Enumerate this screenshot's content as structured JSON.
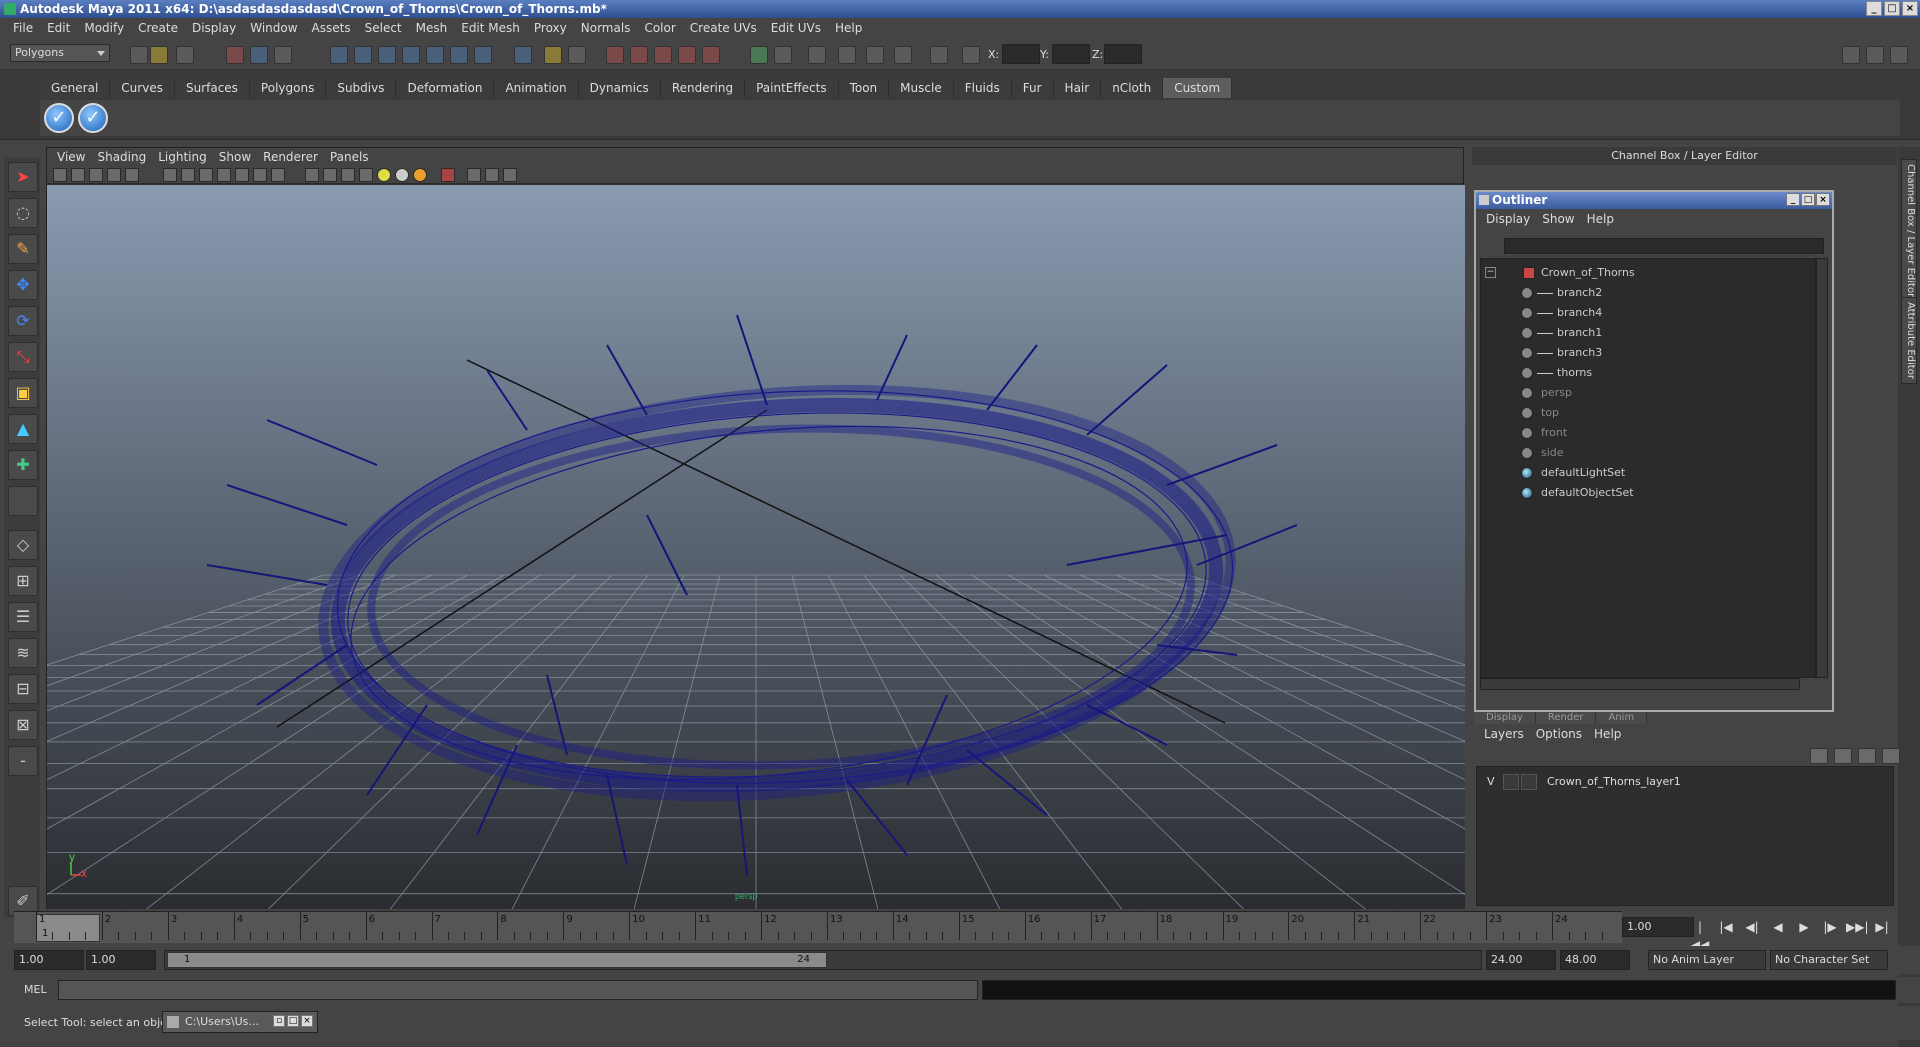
{
  "window": {
    "title": "Autodesk Maya 2011 x64: D:\\asdasdasdasdasd\\Crown_of_Thorns\\Crown_of_Thorns.mb*"
  },
  "menus": [
    "File",
    "Edit",
    "Modify",
    "Create",
    "Display",
    "Window",
    "Assets",
    "Select",
    "Mesh",
    "Edit Mesh",
    "Proxy",
    "Normals",
    "Color",
    "Create UVs",
    "Edit UVs",
    "Help"
  ],
  "status_line": {
    "mode": "Polygons",
    "x_label": "X:",
    "y_label": "Y:",
    "z_label": "Z:"
  },
  "shelf": {
    "tabs": [
      "General",
      "Curves",
      "Surfaces",
      "Polygons",
      "Subdivs",
      "Deformation",
      "Animation",
      "Dynamics",
      "Rendering",
      "PaintEffects",
      "Toon",
      "Muscle",
      "Fluids",
      "Fur",
      "Hair",
      "nCloth",
      "Custom"
    ],
    "active_tab": "Custom"
  },
  "viewport": {
    "menus": [
      "View",
      "Shading",
      "Lighting",
      "Show",
      "Renderer",
      "Panels"
    ],
    "axis_y": "y",
    "axis_x": "x",
    "camera_label": "persp"
  },
  "channel_box": {
    "title": "Channel Box / Layer Editor",
    "side_tab_1": "Channel Box / Layer Editor",
    "side_tab_2": "Attribute Editor"
  },
  "outliner": {
    "title": "Outliner",
    "menus": [
      "Display",
      "Show",
      "Help"
    ],
    "items": [
      {
        "label": "Crown_of_Thorns",
        "level": 0,
        "dim": false,
        "kind": "root"
      },
      {
        "label": "branch2",
        "level": 1,
        "dim": false,
        "kind": "mesh"
      },
      {
        "label": "branch4",
        "level": 1,
        "dim": false,
        "kind": "mesh"
      },
      {
        "label": "branch1",
        "level": 1,
        "dim": false,
        "kind": "mesh"
      },
      {
        "label": "branch3",
        "level": 1,
        "dim": false,
        "kind": "mesh"
      },
      {
        "label": "thorns",
        "level": 1,
        "dim": false,
        "kind": "mesh"
      },
      {
        "label": "persp",
        "level": 0,
        "dim": true,
        "kind": "camera"
      },
      {
        "label": "top",
        "level": 0,
        "dim": true,
        "kind": "camera"
      },
      {
        "label": "front",
        "level": 0,
        "dim": true,
        "kind": "camera"
      },
      {
        "label": "side",
        "level": 0,
        "dim": true,
        "kind": "camera"
      },
      {
        "label": "defaultLightSet",
        "level": 0,
        "dim": false,
        "kind": "set"
      },
      {
        "label": "defaultObjectSet",
        "level": 0,
        "dim": false,
        "kind": "set"
      }
    ]
  },
  "layer_editor": {
    "tabs": [
      "Display",
      "Render",
      "Anim"
    ],
    "menus": [
      "Layers",
      "Options",
      "Help"
    ],
    "layer": {
      "visibility": "V",
      "name": "Crown_of_Thorns_layer1"
    }
  },
  "timeline": {
    "ticks": [
      "1",
      "2",
      "3",
      "4",
      "5",
      "6",
      "7",
      "8",
      "9",
      "10",
      "11",
      "12",
      "13",
      "14",
      "15",
      "16",
      "17",
      "18",
      "19",
      "20",
      "21",
      "22",
      "23",
      "24"
    ],
    "current_frame_label": "1",
    "current_time": "1.00"
  },
  "playback": {
    "buttons": [
      "|◀◀",
      "|◀",
      "◀|",
      "◀",
      "▶",
      "|▶",
      "▶▶|",
      "▶|"
    ]
  },
  "range": {
    "start": "1.00",
    "playback_start": "1.00",
    "handle_start": "1",
    "handle_end": "24",
    "playback_end": "24.00",
    "end": "48.00",
    "anim_layer": "No Anim Layer",
    "character_set": "No Character Set"
  },
  "command_line": {
    "label": "MEL"
  },
  "help_line": {
    "text": "Select Tool: select an object",
    "task_button": "C:\\Users\\Us..."
  }
}
